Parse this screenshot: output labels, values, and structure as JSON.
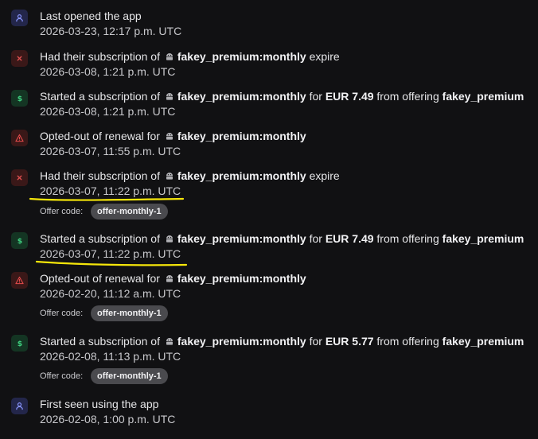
{
  "events": [
    {
      "icon": "person-icon",
      "title": "Last opened the app",
      "time": "2026-03-23, 12:17 p.m. UTC"
    },
    {
      "icon": "cross-icon",
      "pre": "Had their subscription of",
      "product": "fakey_premium:monthly",
      "post": "expire",
      "time": "2026-03-08, 1:21 p.m. UTC"
    },
    {
      "icon": "dollar-icon",
      "pre": "Started a subscription of",
      "product": "fakey_premium:monthly",
      "mid": "for",
      "price": "EUR 7.49",
      "from": "from offering",
      "offering": "fakey_premium",
      "time": "2026-03-08, 1:21 p.m. UTC"
    },
    {
      "icon": "warning-icon",
      "pre": "Opted-out of renewal for",
      "product": "fakey_premium:monthly",
      "time": "2026-03-07, 11:55 p.m. UTC"
    },
    {
      "icon": "cross-icon",
      "pre": "Had their subscription of",
      "product": "fakey_premium:monthly",
      "post": "expire",
      "time": "2026-03-07, 11:22 p.m. UTC",
      "offer_label": "Offer code:",
      "offer_code": "offer-monthly-1"
    },
    {
      "icon": "dollar-icon",
      "pre": "Started a subscription of",
      "product": "fakey_premium:monthly",
      "mid": "for",
      "price": "EUR 7.49",
      "from": "from offering",
      "offering": "fakey_premium",
      "time": "2026-03-07, 11:22 p.m. UTC"
    },
    {
      "icon": "warning-icon",
      "pre": "Opted-out of renewal for",
      "product": "fakey_premium:monthly",
      "time": "2026-02-20, 11:12 a.m. UTC",
      "offer_label": "Offer code:",
      "offer_code": "offer-monthly-1"
    },
    {
      "icon": "dollar-icon",
      "pre": "Started a subscription of",
      "product": "fakey_premium:monthly",
      "mid": "for",
      "price": "EUR 5.77",
      "from": "from offering",
      "offering": "fakey_premium",
      "time": "2026-02-08, 11:13 p.m. UTC",
      "offer_label": "Offer code:",
      "offer_code": "offer-monthly-1"
    },
    {
      "icon": "person-icon",
      "title": "First seen using the app",
      "time": "2026-02-08, 1:00 p.m. UTC"
    }
  ],
  "colors": {
    "background": "#111113",
    "highlight": "#f5e60a",
    "person": "#8a96ff",
    "cross": "#e05050",
    "dollar": "#3fcf7f",
    "warning": "#e24b4b"
  }
}
